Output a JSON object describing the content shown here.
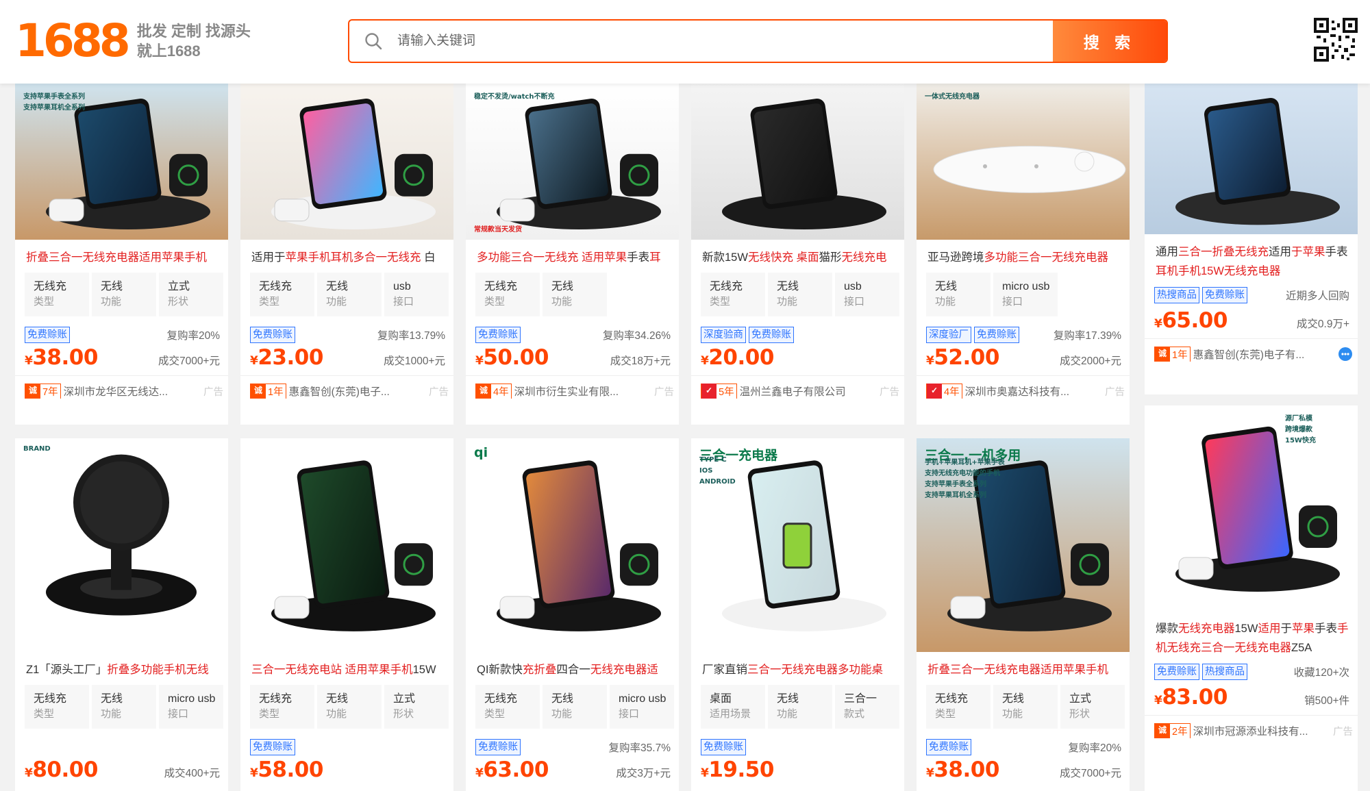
{
  "header": {
    "logo": "1688",
    "slogan_line1": "批发 定制 找源头",
    "slogan_line2": "就上1688",
    "search_placeholder": "请输入关键词",
    "search_button": "搜 索"
  },
  "products": [
    {
      "title_segments": [
        {
          "t": "折叠三合一无线充电器适用苹果手机",
          "h": true
        }
      ],
      "attrs": [
        {
          "v": "无线充",
          "l": "类型"
        },
        {
          "v": "无线",
          "l": "功能"
        },
        {
          "v": "立式",
          "l": "形状"
        }
      ],
      "tags": [
        "免费赊账"
      ],
      "rate": "复购率20%",
      "currency": "¥",
      "price": "38.00",
      "sold": "成交7000+元",
      "years": "7年",
      "company": "深圳市龙华区无线达...",
      "ad": "广告",
      "img_text": [
        "支持苹果手表全系列",
        "支持苹果耳机全系列"
      ]
    },
    {
      "title_segments": [
        {
          "t": "适用于",
          "h": false
        },
        {
          "t": "苹果手机耳机多合一无线充",
          "h": true
        },
        {
          "t": " 白",
          "h": false
        }
      ],
      "attrs": [
        {
          "v": "无线充",
          "l": "类型"
        },
        {
          "v": "无线",
          "l": "功能"
        },
        {
          "v": "usb",
          "l": "接口"
        }
      ],
      "tags": [
        "免费赊账"
      ],
      "rate": "复购率13.79%",
      "currency": "¥",
      "price": "23.00",
      "sold": "成交1000+元",
      "years": "1年",
      "company": "惠鑫智创(东莞)电子...",
      "ad": "广告",
      "img_text": []
    },
    {
      "title_segments": [
        {
          "t": "多功能三合一无线充 适用苹果",
          "h": true
        },
        {
          "t": "手表",
          "h": false
        },
        {
          "t": "耳",
          "h": true
        }
      ],
      "attrs": [
        {
          "v": "无线充",
          "l": "类型"
        },
        {
          "v": "无线",
          "l": "功能"
        }
      ],
      "tags": [
        "免费赊账"
      ],
      "rate": "复购率34.26%",
      "currency": "¥",
      "price": "50.00",
      "sold": "成交18万+元",
      "years": "4年",
      "company": "深圳市衍生实业有限...",
      "ad": "广告",
      "img_text": [
        "稳定不发烫/watch不断充",
        "常规款当天发货"
      ]
    },
    {
      "title_segments": [
        {
          "t": "新款15W",
          "h": false
        },
        {
          "t": "无线快充 桌面",
          "h": true
        },
        {
          "t": "猫形",
          "h": false
        },
        {
          "t": "无线充电",
          "h": true
        }
      ],
      "attrs": [
        {
          "v": "无线充",
          "l": "类型"
        },
        {
          "v": "无线",
          "l": "功能"
        },
        {
          "v": "usb",
          "l": "接口"
        }
      ],
      "tags": [
        "深度验商",
        "免费赊账"
      ],
      "rate": "",
      "currency": "¥",
      "price": "20.00",
      "sold": "",
      "years": "5年",
      "company": "温州兰鑫电子有限公司",
      "ad": "广告",
      "img_text": []
    },
    {
      "title_segments": [
        {
          "t": "亚马逊跨境",
          "h": false
        },
        {
          "t": "多功能三合一无线充电器",
          "h": true
        }
      ],
      "attrs": [
        {
          "v": "无线",
          "l": "功能"
        },
        {
          "v": "micro usb",
          "l": "接口"
        }
      ],
      "tags": [
        "深度验厂",
        "免费赊账"
      ],
      "rate": "复购率17.39%",
      "currency": "¥",
      "price": "52.00",
      "sold": "成交2000+元",
      "years": "4年",
      "company": "深圳市奥嘉达科技有...",
      "ad": "广告",
      "img_text": [
        "一体式无线充电器"
      ]
    },
    {
      "title_segments": [
        {
          "t": "通用",
          "h": false
        },
        {
          "t": "三合一折叠无线充",
          "h": true
        },
        {
          "t": "适用",
          "h": false
        },
        {
          "t": "于苹果",
          "h": true
        },
        {
          "t": "手表",
          "h": false
        },
        {
          "t": "耳机手机15W无线充电器",
          "h": true
        }
      ],
      "attrs": [],
      "tags": [
        "热搜商品",
        "免费赊账"
      ],
      "rate": "近期多人回购",
      "currency": "¥",
      "price": "65.00",
      "sold": "成交0.9万+",
      "years": "1年",
      "company": "惠鑫智创(东莞)电子有...",
      "ad": "",
      "img_text": []
    },
    {
      "title_segments": [
        {
          "t": "Z1「源头工厂」",
          "h": false
        },
        {
          "t": "折叠多功能手机无线",
          "h": true
        }
      ],
      "attrs": [
        {
          "v": "无线充",
          "l": "类型"
        },
        {
          "v": "无线",
          "l": "功能"
        },
        {
          "v": "micro usb",
          "l": "接口"
        }
      ],
      "tags": [],
      "rate": "",
      "currency": "¥",
      "price": "80.00",
      "sold": "成交400+元",
      "years": "",
      "company": "",
      "ad": "",
      "img_text": [
        "BRAND"
      ]
    },
    {
      "title_segments": [
        {
          "t": "三合一无线充电站 适用苹果手机",
          "h": true
        },
        {
          "t": "15W",
          "h": false
        }
      ],
      "attrs": [
        {
          "v": "无线充",
          "l": "类型"
        },
        {
          "v": "无线",
          "l": "功能"
        },
        {
          "v": "立式",
          "l": "形状"
        }
      ],
      "tags": [
        "免费赊账"
      ],
      "rate": "",
      "currency": "¥",
      "price": "58.00",
      "sold": "",
      "years": "",
      "company": "",
      "ad": "",
      "img_text": []
    },
    {
      "title_segments": [
        {
          "t": "QI新款快",
          "h": false
        },
        {
          "t": "充折叠",
          "h": true
        },
        {
          "t": "四合一",
          "h": false
        },
        {
          "t": "无线充电器适",
          "h": true
        }
      ],
      "attrs": [
        {
          "v": "无线充",
          "l": "类型"
        },
        {
          "v": "无线",
          "l": "功能"
        },
        {
          "v": "micro usb",
          "l": "接口"
        }
      ],
      "tags": [
        "免费赊账"
      ],
      "rate": "复购率35.7%",
      "currency": "¥",
      "price": "63.00",
      "sold": "成交3万+元",
      "years": "",
      "company": "",
      "ad": "",
      "img_text": [
        "qi"
      ]
    },
    {
      "title_segments": [
        {
          "t": "厂家直销",
          "h": false
        },
        {
          "t": "三合一无线充电器多功能桌",
          "h": true
        }
      ],
      "attrs": [
        {
          "v": "桌面",
          "l": "适用场景"
        },
        {
          "v": "无线",
          "l": "功能"
        },
        {
          "v": "三合一",
          "l": "款式"
        }
      ],
      "tags": [
        "免费赊账"
      ],
      "rate": "",
      "currency": "¥",
      "price": "19.50",
      "sold": "",
      "years": "",
      "company": "",
      "ad": "",
      "img_text": [
        "三合一充电器",
        "TYPE-C",
        "IOS",
        "ANDROID"
      ]
    },
    {
      "title_segments": [
        {
          "t": "折叠三合一无线充电器适用苹果手机",
          "h": true
        }
      ],
      "attrs": [
        {
          "v": "无线充",
          "l": "类型"
        },
        {
          "v": "无线",
          "l": "功能"
        },
        {
          "v": "立式",
          "l": "形状"
        }
      ],
      "tags": [
        "免费赊账"
      ],
      "rate": "复购率20%",
      "currency": "¥",
      "price": "38.00",
      "sold": "成交7000+元",
      "years": "",
      "company": "",
      "ad": "",
      "img_text": [
        "三合一.一机多用",
        "手机+苹果耳机+苹果手表",
        "支持无线充电功能的手机",
        "支持苹果手表全系列",
        "支持苹果耳机全系列"
      ]
    },
    {
      "title_segments": [
        {
          "t": "爆款",
          "h": false
        },
        {
          "t": "无线充电器",
          "h": true
        },
        {
          "t": "15W",
          "h": false
        },
        {
          "t": "适用",
          "h": true
        },
        {
          "t": "于",
          "h": false
        },
        {
          "t": "苹果",
          "h": true
        },
        {
          "t": "手表",
          "h": false
        },
        {
          "t": "手机无线充三合一无线充电器",
          "h": true
        },
        {
          "t": "Z5A",
          "h": false
        }
      ],
      "attrs": [],
      "tags": [
        "免费赊账",
        "热搜商品"
      ],
      "rate": "收藏120+次",
      "currency": "¥",
      "price": "83.00",
      "sold": "销500+件",
      "years": "2年",
      "company": "深圳市冠源添业科技有...",
      "ad": "广告",
      "img_text": [
        "源厂私模",
        "跨境爆款",
        "15W快充"
      ]
    }
  ],
  "colors": {
    "brand": "#ff6a00",
    "price": "#ff4400",
    "highlight": "#e32020",
    "tag": "#2d74ff"
  }
}
